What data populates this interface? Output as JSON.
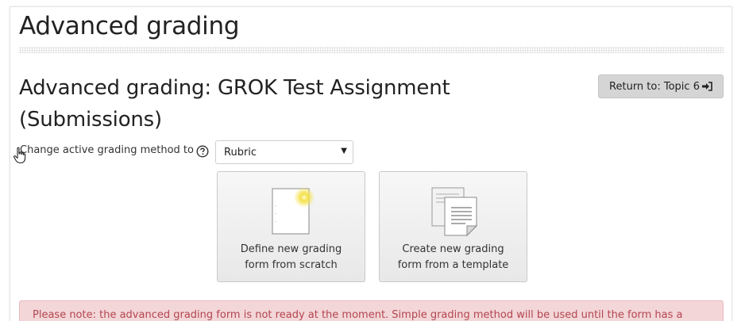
{
  "page": {
    "title": "Advanced grading",
    "assignment_heading": "Advanced grading: GROK Test Assignment (Submissions)"
  },
  "return_button": {
    "label": "Return to: Topic 6",
    "icon": "sign-in-icon"
  },
  "grading_method": {
    "label": "Change active grading method to",
    "help_icon": "question-circle-icon",
    "selected": "Rubric"
  },
  "options": [
    {
      "label": "Define new grading form from scratch",
      "icon": "blank-document-icon"
    },
    {
      "label": "Create new grading form from a template",
      "icon": "stacked-documents-icon"
    }
  ],
  "notice": {
    "text": "Please note: the advanced grading form is not ready at the moment. Simple grading method will be used until the form has a"
  },
  "colors": {
    "button_bg": "#d5d5d5",
    "alert_bg": "#f3d6d8",
    "alert_text": "#b3464f",
    "highlight": "#f5e14a"
  }
}
